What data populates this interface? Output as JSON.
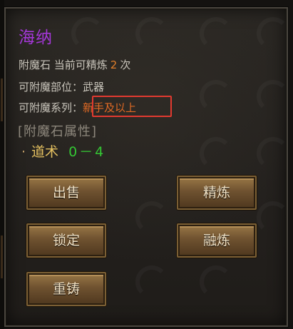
{
  "item": {
    "name": "海纳",
    "refine_prefix": "附魔石  当前可精炼",
    "refine_count": "2",
    "refine_suffix": "次",
    "slot_label": "可附魔部位：",
    "slot_value": "武器",
    "series_label": "可附魔系列：",
    "series_value": "新手及以上",
    "attr_header": "[附魔石属性]",
    "attr_bullet": "·",
    "attr_name": "道术",
    "attr_value": "0－4"
  },
  "buttons": {
    "sell": "出售",
    "refine": "精炼",
    "lock": "锁定",
    "fuse": "融炼",
    "recast": "重铸"
  },
  "colors": {
    "title": "#a437d8",
    "count": "#e27f2a",
    "series": "#e06a24",
    "highlight_box": "#e23a30",
    "attr_name": "#e4c060",
    "attr_value": "#34c534"
  }
}
